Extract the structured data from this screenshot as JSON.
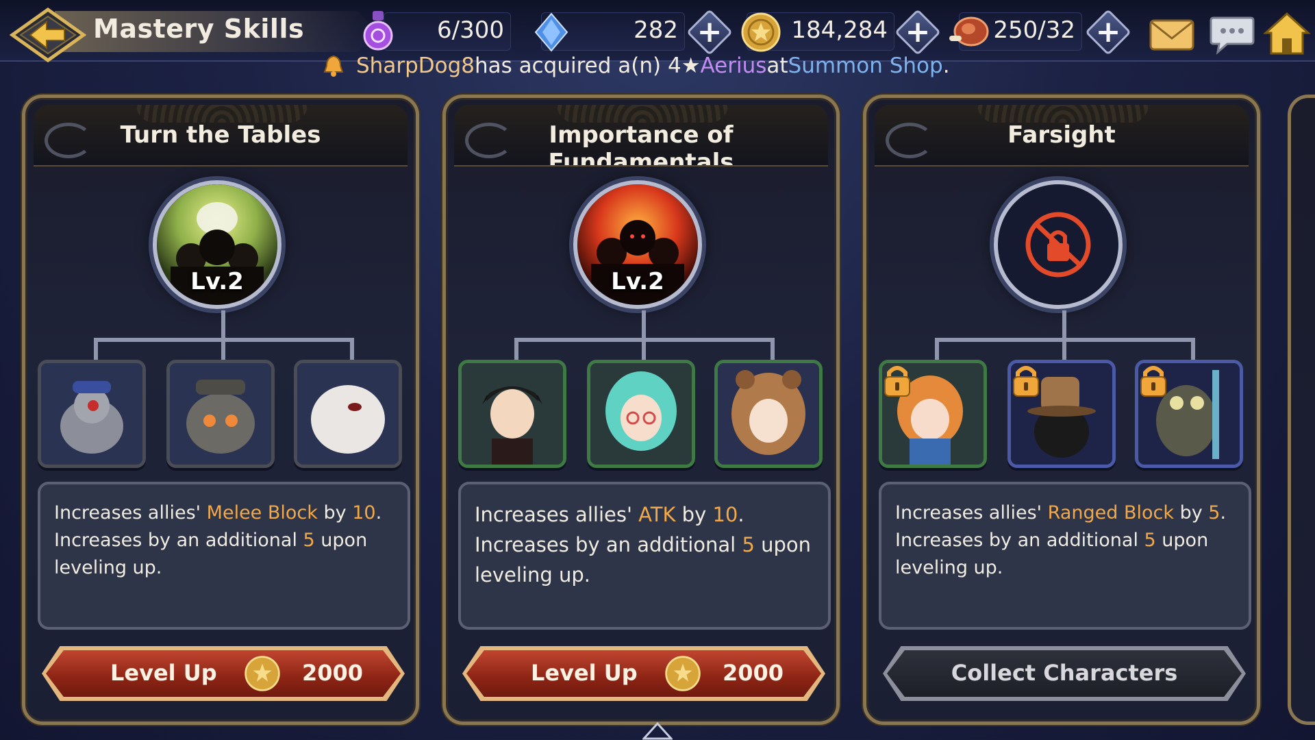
{
  "header": {
    "title": "Mastery Skills",
    "resources": [
      {
        "name": "stamina",
        "icon": "potion-icon",
        "value": "6/300"
      },
      {
        "name": "gems",
        "icon": "crystal-icon",
        "value": "282"
      },
      {
        "name": "gold",
        "icon": "coin-icon",
        "value": "184,284"
      },
      {
        "name": "meat",
        "icon": "meat-icon",
        "value": "250/32"
      }
    ]
  },
  "ticker": {
    "user": "SharpDog8",
    "text1": " has acquired a(n) 4★ ",
    "hero": "Aerius",
    "text2": " at ",
    "shop": "Summon Shop",
    "text3": "."
  },
  "cards": [
    {
      "title": "Turn the Tables",
      "level": "Lv.2",
      "locked": false,
      "desc": {
        "pre": "Increases allies' ",
        "stat": "Melee Block",
        "mid": " by ",
        "amount": "10",
        "line2_pre": ". Increases by an additional ",
        "extra": "5",
        "post": " upon leveling up."
      },
      "button": {
        "label": "Level Up",
        "cost": "2000"
      }
    },
    {
      "title": "Importance of Fundamentals",
      "level": "Lv.2",
      "locked": false,
      "desc": {
        "pre": "Increases allies' ",
        "stat": "ATK",
        "mid": " by ",
        "amount": "10",
        "line2_pre": ". Increases by an additional ",
        "extra": "5",
        "post": " upon leveling up."
      },
      "button": {
        "label": "Level Up",
        "cost": "2000"
      }
    },
    {
      "title": "Farsight",
      "level": "",
      "locked": true,
      "desc": {
        "pre": "Increases allies' ",
        "stat": "Ranged Block",
        "mid": " by ",
        "amount": "5",
        "line2_pre": ". Increases by an additional ",
        "extra": "5",
        "post": " upon leveling up."
      },
      "button": {
        "label": "Collect Characters"
      }
    }
  ],
  "colors": {
    "highlight": "#f2a94a",
    "user": "#f2c98a",
    "hero": "#c48cf2",
    "shop": "#7fb3ee",
    "card_border": "#8a7752"
  }
}
